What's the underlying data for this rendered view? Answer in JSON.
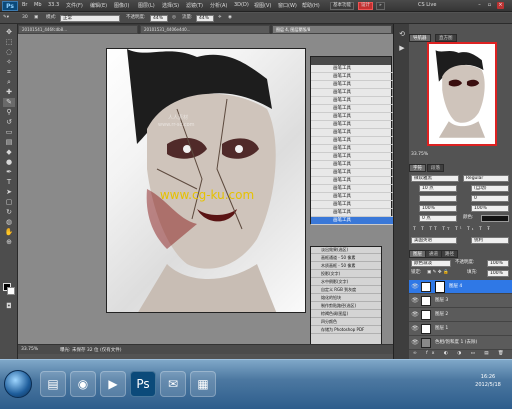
{
  "app": {
    "logo": "Ps",
    "menus": [
      "文件(F)",
      "编辑(E)",
      "图像(I)",
      "图层(L)",
      "选择(S)",
      "滤镜(T)",
      "分析(A)",
      "3D(D)",
      "视图(V)",
      "窗口(W)",
      "帮助(H)"
    ],
    "zoom": "33.3",
    "workspace_buttons": [
      "基本功能",
      "设计"
    ],
    "cs_live": "CS Live"
  },
  "options": {
    "brush_size": "30",
    "mode_label": "模式:",
    "mode_value": "正常",
    "opacity_label": "不透明度:",
    "opacity_value": "44%",
    "flow_label": "流量:",
    "flow_value": "44%"
  },
  "tabs": [
    "20101541_446fcdb8... ",
    "20101531_4406e4d0...",
    "图层 4, 图层蒙版/8"
  ],
  "status": {
    "zoom": "33.75%",
    "info": "曝光: 未保存 32 位 (仅有文件)"
  },
  "history": {
    "items": [
      "画笔工具",
      "画笔工具",
      "画笔工具",
      "画笔工具",
      "画笔工具",
      "画笔工具",
      "画笔工具",
      "画笔工具",
      "画笔工具",
      "画笔工具",
      "画笔工具",
      "画笔工具",
      "画笔工具",
      "画笔工具",
      "画笔工具",
      "画笔工具",
      "画笔工具",
      "画笔工具",
      "画笔工具",
      "画笔工具"
    ],
    "selected_label": "画笔工具"
  },
  "actions": {
    "items": [
      "淡出效果(选区)",
      "画框通道 - 50 像素",
      "木质画框 - 50 像素",
      "投影(文字)",
      "水中倒影(文字)",
      "自定义 RGB 到灰度",
      "熔化的铅块",
      "制作剪贴路径(选区)",
      "棕褐色调(图层)",
      "四分颜色",
      "存储为 Photoshop PDF"
    ]
  },
  "right_panels": {
    "nav_tabs": [
      "导航器",
      "直方图"
    ],
    "nav_zoom": "33.75%",
    "char_tabs": [
      "字符",
      "段落"
    ],
    "font_family": "微软雅黑",
    "font_style": "Regular",
    "font_size": "10 点",
    "leading": "(自动)",
    "tracking": "0",
    "vscale": "100%",
    "hscale": "100%",
    "baseline": "0 点",
    "color_label": "颜色:",
    "lang": "美国英语",
    "aa": "锐利",
    "layers_tabs": [
      "图层",
      "通道",
      "路径"
    ],
    "blend_mode": "颜色减淡",
    "opacity_label": "不透明度:",
    "opacity": "100%",
    "lock_label": "锁定:",
    "fill_label": "填充:",
    "fill": "100%",
    "layers": [
      "图层 4",
      "图层 3",
      "图层 2",
      "图层 1",
      "色相/饱和度 1 (去除)"
    ]
  },
  "taskbar": {
    "time": "16:26",
    "date": "2012/5/18"
  },
  "watermarks": [
    "人人素材",
    "www.rr-sc.com",
    "www.cg-ku.com"
  ],
  "colors": {
    "selection_blue": "#2f78e6",
    "workspace_red": "#c33030"
  }
}
